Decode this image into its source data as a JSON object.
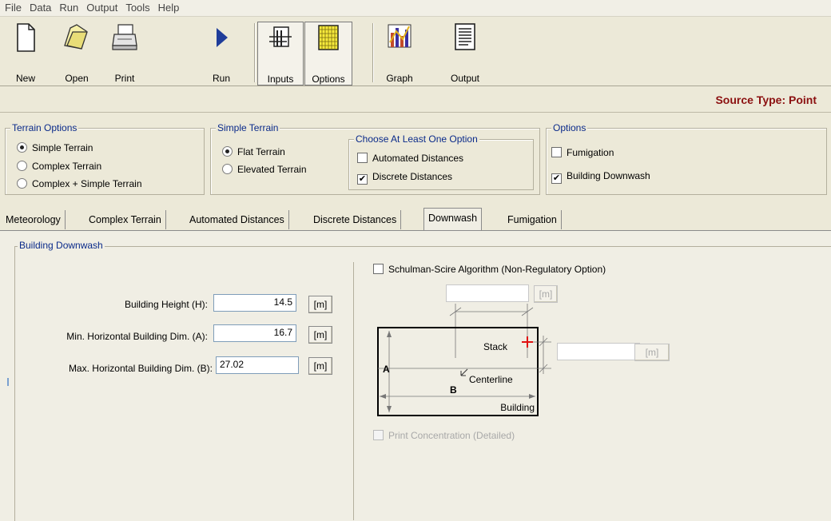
{
  "menu": [
    "File",
    "Data",
    "Run",
    "Output",
    "Tools",
    "Help"
  ],
  "toolbar": [
    {
      "label": "New",
      "icon": "new-document-icon"
    },
    {
      "label": "Open",
      "icon": "open-folder-icon"
    },
    {
      "label": "Print",
      "icon": "printer-icon"
    },
    {
      "label": "Run",
      "icon": "run-triangle-icon"
    },
    {
      "label": "Inputs",
      "icon": "inputs-icon"
    },
    {
      "label": "Options",
      "icon": "options-grid-icon"
    },
    {
      "label": "Graph",
      "icon": "graph-icon"
    },
    {
      "label": "Output",
      "icon": "output-icon"
    }
  ],
  "source_type": "Source Type: Point",
  "terrain_options": {
    "title": "Terrain Options",
    "items": [
      {
        "label": "Simple Terrain",
        "selected": true
      },
      {
        "label": "Complex Terrain",
        "selected": false
      },
      {
        "label": "Complex + Simple Terrain",
        "selected": false
      }
    ]
  },
  "simple_terrain": {
    "title": "Simple Terrain",
    "items": [
      {
        "label": "Flat Terrain",
        "selected": true
      },
      {
        "label": "Elevated Terrain",
        "selected": false
      }
    ]
  },
  "choose_option": {
    "title": "Choose At Least One Option",
    "items": [
      {
        "label": "Automated Distances",
        "checked": false
      },
      {
        "label": "Discrete Distances",
        "checked": true
      }
    ]
  },
  "options": {
    "title": "Options",
    "items": [
      {
        "label": "Fumigation",
        "checked": false
      },
      {
        "label": "Building Downwash",
        "checked": true
      }
    ]
  },
  "tabs": [
    "Meteorology",
    "Complex Terrain",
    "Automated Distances",
    "Discrete Distances",
    "Downwash",
    "Fumigation"
  ],
  "active_tab": "Downwash",
  "downwash": {
    "title": "Building Downwash",
    "fields": [
      {
        "label": "Building Height (H):",
        "value": "14.5",
        "unit": "[m]"
      },
      {
        "label": "Min. Horizontal Building Dim. (A):",
        "value": "16.7",
        "unit": "[m]"
      },
      {
        "label": "Max. Horizontal Building Dim. (B):",
        "value": "27.02",
        "unit": "[m]"
      }
    ],
    "schulman": {
      "label": "Schulman-Scire Algorithm (Non-Regulatory Option)",
      "checked": false
    },
    "top_field": {
      "value": "",
      "unit": "[m]"
    },
    "side_field": {
      "value": "",
      "unit": "[m]"
    },
    "diagram": {
      "stack": "Stack",
      "centerline": "Centerline",
      "building": "Building",
      "dim_a": "A",
      "dim_b": "B"
    },
    "print_conc": {
      "label": "Print Concentration (Detailed)",
      "checked": false
    }
  }
}
